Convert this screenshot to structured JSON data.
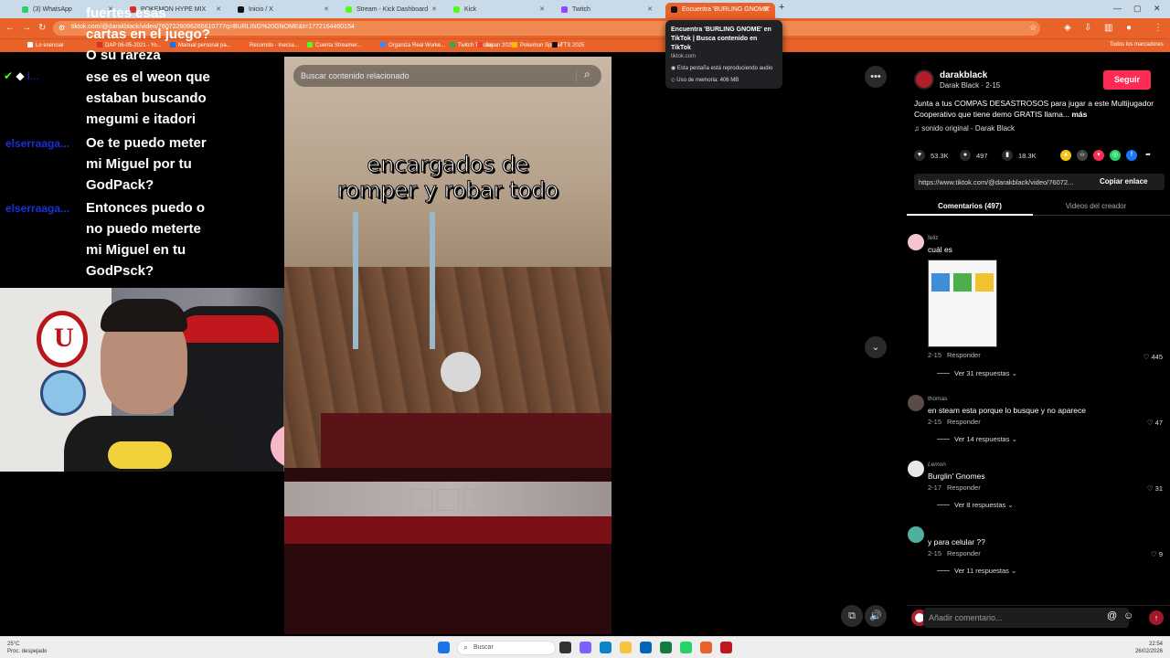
{
  "browser": {
    "tabs": [
      {
        "label": "(3) WhatsApp",
        "color": "#25d366"
      },
      {
        "label": "POKEMON HYPE MIX",
        "color": "#d93025"
      },
      {
        "label": "Inicio / X",
        "color": "#111111"
      },
      {
        "label": "Stream - Kick Dashboard",
        "color": "#53fc18"
      },
      {
        "label": "Kick",
        "color": "#53fc18"
      },
      {
        "label": "Twitch",
        "color": "#9146ff"
      },
      {
        "label": "Encuentra 'BURLING GNOME'",
        "color": "#111111"
      }
    ],
    "new_tab": "+",
    "url": "tiktok.com/@darakblack/video/7607226096265610777q=BURLING%20GNOME&t=1772164460154",
    "bookmarks": [
      {
        "label": "Lo esencial",
        "color": "#ffffff"
      },
      {
        "label": "DAP 06-05-2021 - Yo...",
        "color": "#d93025"
      },
      {
        "label": "Manual personal pa...",
        "color": "#1a73e8"
      },
      {
        "label": "Recorrido - Inecsa...",
        "color": "#ff5722"
      },
      {
        "label": "Cuenta Streamer...",
        "color": "#53fc18"
      },
      {
        "label": "Organiza Real Worke...",
        "color": "#4285f4"
      },
      {
        "label": "Twitch Tracker",
        "color": "#34a853"
      },
      {
        "label": "Japan 2025",
        "color": "#ea4335"
      },
      {
        "label": "Pokemon Spoiler",
        "color": "#fbbc05"
      },
      {
        "label": "TTS 2025",
        "color": "#111111"
      }
    ],
    "all_bookmarks": "Todos los marcadores"
  },
  "tooltip": {
    "title": "Encuentra 'BURLING GNOME' en TikTok | Busca contenido en TikTok",
    "host": "tiktok.com",
    "audio": "Esta pestaña está reproduciendo audio",
    "memory": "Uso de memoria: 406 MB"
  },
  "chat": {
    "lines": [
      "fuertes esas",
      "cartas en el juego?",
      "O su rareza",
      "ese es el weon que",
      "estaban buscando",
      "megumi e itadori",
      "Oe te puedo meter",
      "mi Miguel por tu",
      "GodPack?",
      "Entonces puedo o",
      "no puedo meterte",
      "mi Miguel en tu",
      "GodPsck?"
    ],
    "users": [
      "elserraaga...",
      "elserraaga..."
    ]
  },
  "video": {
    "search_placeholder": "Buscar contenido relacionado",
    "caption_line1": "encargados de",
    "caption_line2": "romper y robar todo"
  },
  "post": {
    "username": "darakblack",
    "display": "Darak Black · 2-15",
    "follow": "Seguir",
    "description": "Junta a tus COMPAS DESASTROSOS para jugar a este Multijugador Cooperativo que tiene demo GRATIS llama...",
    "more": "más",
    "sound": "sonido original - Darak Black",
    "likes": "53.3K",
    "comments_count": "497",
    "saves": "18.3K",
    "link": "https://www.tiktok.com/@darakblack/video/76072...",
    "copy_link": "Copiar enlace",
    "tab_comments": "Comentarios (497)",
    "tab_creator": "Videos del creador"
  },
  "comments": [
    {
      "user": "feliz",
      "text": "cuál es",
      "date": "2-15",
      "reply": "Responder",
      "likes": "445",
      "replies": "Ver 31 respuestas",
      "av": "#f3c6d0"
    },
    {
      "user": "thomas",
      "text": "en steam esta porque lo busque y no aparece",
      "date": "2-15",
      "reply": "Responder",
      "likes": "47",
      "replies": "Ver 14 respuestas",
      "av": "#5a4a48"
    },
    {
      "user": "Lemon",
      "text": "Burglin' Gnomes",
      "date": "2-17",
      "reply": "Responder",
      "likes": "31",
      "replies": "Ver 8 respuestas",
      "av": "#e8e8e8"
    },
    {
      "user": "",
      "text": "y para celular ??",
      "date": "2-15",
      "reply": "Responder",
      "likes": "9",
      "replies": "Ver 11 respuestas",
      "av": "#4fb0a0"
    }
  ],
  "comment_box": {
    "placeholder": "Añadir comentario..."
  },
  "taskbar": {
    "weather_temp": "25°C",
    "weather_desc": "Proc. despejado",
    "search": "Buscar",
    "time": "22:54",
    "date": "26/02/2026"
  },
  "colors": {
    "brand": "#e8622a",
    "tiktok_red": "#fe2c55"
  }
}
